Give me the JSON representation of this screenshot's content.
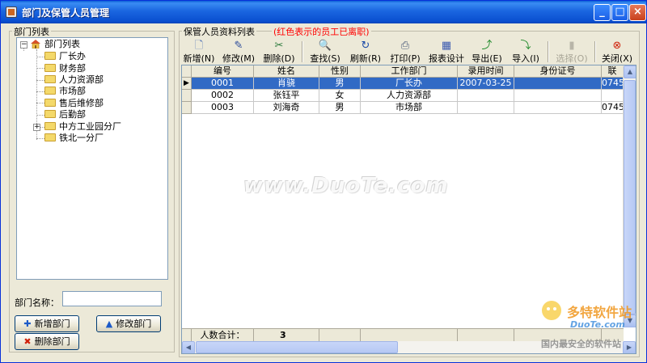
{
  "window": {
    "title": "部门及保管人员管理"
  },
  "titlebar_buttons": [
    "_",
    "□",
    "×"
  ],
  "left_panel": {
    "group_title": "部门列表",
    "tree_root": "部门列表",
    "tree_items": [
      "厂长办",
      "财务部",
      "人力资源部",
      "市场部",
      "售后维修部",
      "后勤部",
      "中方工业园分厂",
      "铁北一分厂"
    ],
    "expander_root": "−",
    "expander_child": "+",
    "dept_name_label": "部门名称：",
    "dept_name_value": "",
    "buttons": {
      "add": "新增部门",
      "edit": "修改部门",
      "delete": "删除部门"
    }
  },
  "right_panel": {
    "group_title": "保管人员资料列表",
    "note": "(红色表示的员工已离职)",
    "note_color": "#ff0000",
    "toolbar": [
      {
        "label": "新增(N)",
        "icon": "new-document-icon"
      },
      {
        "label": "修改(M)",
        "icon": "edit-icon"
      },
      {
        "label": "删除(D)",
        "icon": "delete-icon"
      },
      {
        "label": "查找(S)",
        "icon": "search-icon"
      },
      {
        "label": "刷新(R)",
        "icon": "refresh-icon"
      },
      {
        "label": "打印(P)",
        "icon": "printer-icon"
      },
      {
        "label": "报表设计",
        "icon": "report-icon"
      },
      {
        "label": "导出(E)",
        "icon": "export-icon"
      },
      {
        "label": "导入(I)",
        "icon": "import-icon"
      },
      {
        "label": "选择(O)",
        "icon": "select-icon",
        "disabled": true
      },
      {
        "label": "关闭(X)",
        "icon": "close-icon"
      }
    ],
    "grid": {
      "columns": [
        "编号",
        "姓名",
        "性别",
        "工作部门",
        "录用时间",
        "身份证号",
        "联"
      ],
      "rows": [
        [
          "0001",
          "肖骁",
          "男",
          "厂长办",
          "2007-03-25",
          "",
          "0745-"
        ],
        [
          "0002",
          "张钰平",
          "女",
          "人力资源部",
          "",
          "",
          ""
        ],
        [
          "0003",
          "刘海奇",
          "男",
          "市场部",
          "",
          "",
          "0745-"
        ]
      ],
      "selected_row": 0,
      "footer_label": "人数合计：",
      "footer_count": "3"
    }
  },
  "watermark": {
    "text": "www.DuoTe.com",
    "logo_text": "多特软件站",
    "logo_sub": "DuoTe.com",
    "slogan": "国内最安全的软件站"
  }
}
